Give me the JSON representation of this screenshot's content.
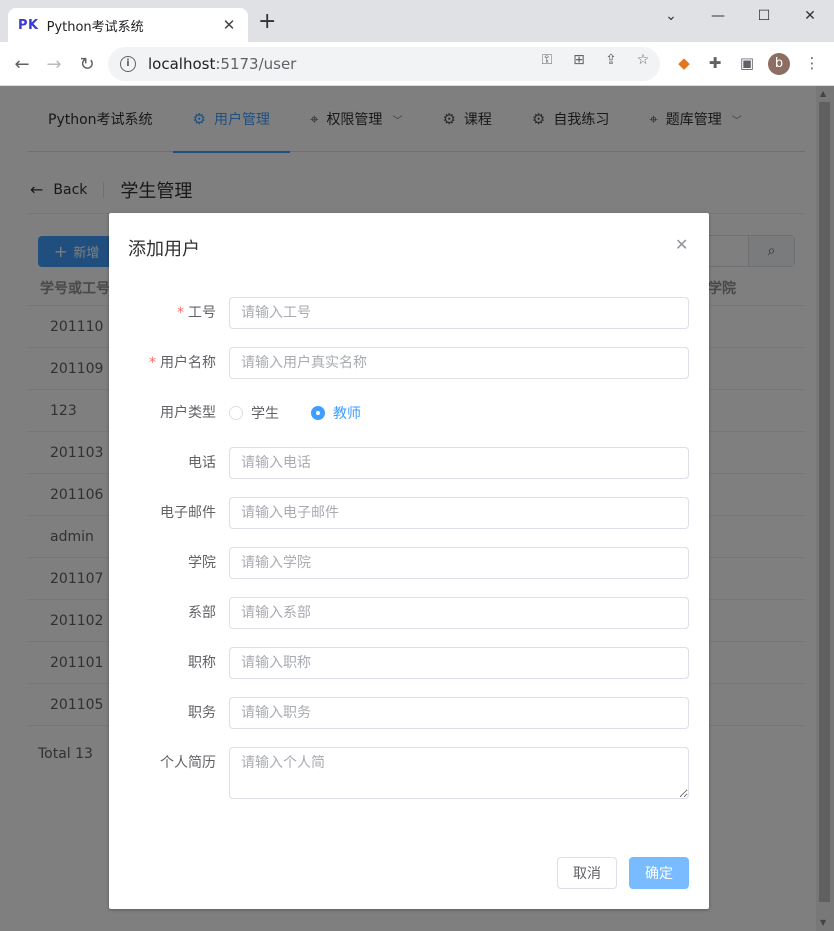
{
  "browser": {
    "tab_favicon": "PK",
    "tab_title": "Python考试系统",
    "tab_close": "✕",
    "new_tab": "+",
    "url_host": "localhost",
    "url_rest": ":5173/user",
    "avatar_letter": "b"
  },
  "nav": {
    "brand": "Python考试系统",
    "items": [
      {
        "label": "用户管理",
        "icon": "gear-icon",
        "active": true
      },
      {
        "label": "权限管理",
        "icon": "location-icon",
        "dropdown": true
      },
      {
        "label": "课程",
        "icon": "gear-icon"
      },
      {
        "label": "自我练习",
        "icon": "gear-icon"
      },
      {
        "label": "题库管理",
        "icon": "location-icon",
        "dropdown": true
      }
    ]
  },
  "page_header": {
    "back_label": "Back",
    "title": "学生管理"
  },
  "toolbar": {
    "new_label": "新增"
  },
  "table": {
    "columns": [
      "学号或工号",
      "学院"
    ],
    "rows": [
      "201110",
      "201109",
      "123",
      "201103",
      "201106",
      "admin",
      "201107",
      "201102",
      "201101",
      "201105"
    ]
  },
  "pagination": {
    "total": "Total 13"
  },
  "dialog": {
    "title": "添加用户",
    "fields": {
      "job_no": {
        "label": "工号",
        "placeholder": "请输入工号",
        "required": true
      },
      "name": {
        "label": "用户名称",
        "placeholder": "请输入用户真实名称",
        "required": true
      },
      "user_type": {
        "label": "用户类型",
        "options": [
          "学生",
          "教师"
        ],
        "selected": "教师"
      },
      "phone": {
        "label": "电话",
        "placeholder": "请输入电话"
      },
      "email": {
        "label": "电子邮件",
        "placeholder": "请输入电子邮件"
      },
      "college": {
        "label": "学院",
        "placeholder": "请输入学院"
      },
      "department": {
        "label": "系部",
        "placeholder": "请输入系部"
      },
      "title": {
        "label": "职称",
        "placeholder": "请输入职称"
      },
      "position": {
        "label": "职务",
        "placeholder": "请输入职务"
      },
      "bio": {
        "label": "个人简历",
        "placeholder": "请输入个人简"
      }
    },
    "cancel_label": "取消",
    "confirm_label": "确定"
  },
  "colors": {
    "primary": "#409eff",
    "primary_light": "#79bbff",
    "required": "#f56c6c"
  }
}
